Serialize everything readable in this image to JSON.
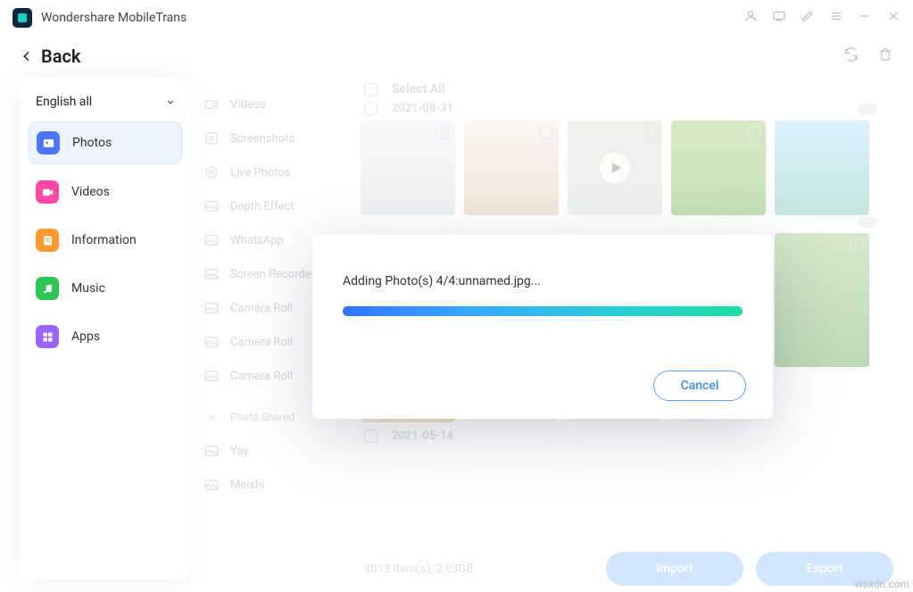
{
  "app": {
    "title": "Wondershare MobileTrans"
  },
  "nav": {
    "back": "Back"
  },
  "language": {
    "label": "English all"
  },
  "sidebar": {
    "items": [
      {
        "label": "Photos"
      },
      {
        "label": "Videos"
      },
      {
        "label": "Information"
      },
      {
        "label": "Music"
      },
      {
        "label": "Apps"
      }
    ]
  },
  "subcategories": {
    "items": [
      {
        "label": "Videos"
      },
      {
        "label": "Screenshots"
      },
      {
        "label": "Live Photos"
      },
      {
        "label": "Depth Effect"
      },
      {
        "label": "WhatsApp"
      },
      {
        "label": "Screen Recorder"
      },
      {
        "label": "Camera Roll"
      },
      {
        "label": "Camera Roll"
      },
      {
        "label": "Camera Roll"
      }
    ],
    "group1": "Photo Shared",
    "extra": [
      {
        "label": "Yay"
      },
      {
        "label": "Meishi"
      }
    ]
  },
  "grid": {
    "select_all": "Select All",
    "date1": "2021-08-31",
    "date2": "2021-05-14"
  },
  "footer": {
    "stats": "3013 Item(s), 2.03GB",
    "import": "Import",
    "export": "Export"
  },
  "modal": {
    "message": "Adding Photo(s) 4/4:unnamed.jpg...",
    "cancel": "Cancel"
  },
  "watermark": "wsxdn.com"
}
